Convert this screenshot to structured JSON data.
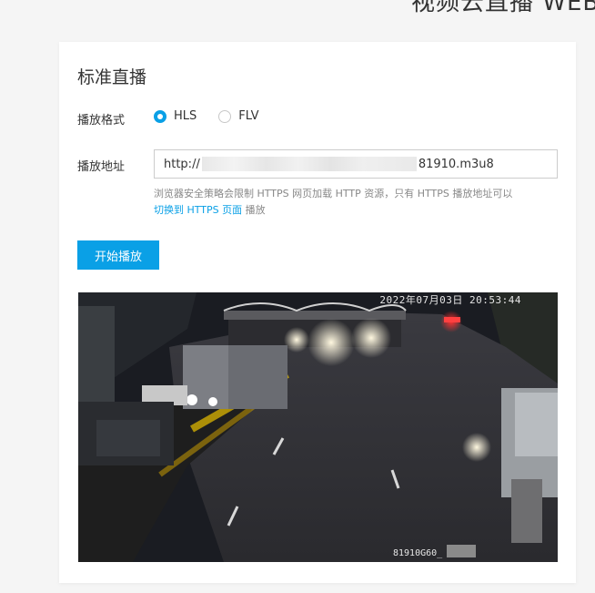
{
  "header": {
    "title": "视频云直播 WEB"
  },
  "card": {
    "title": "标准直播",
    "format": {
      "label": "播放格式",
      "options": [
        {
          "label": "HLS",
          "checked": true
        },
        {
          "label": "FLV",
          "checked": false
        }
      ]
    },
    "address": {
      "label": "播放地址",
      "url_prefix": "http://",
      "url_suffix": "81910.m3u8"
    },
    "hint": {
      "text_before": "浏览器安全策略会限制 HTTPS 网页加载 HTTP 资源，只有 HTTPS 播放地址可以",
      "link": "切换到 HTTPS 页面",
      "text_after": " 播放"
    },
    "start_button": "开始播放"
  },
  "video": {
    "timestamp": "2022年07月03日 20:53:44",
    "camera_id": "81910G60_"
  },
  "colors": {
    "accent": "#0aa0e6"
  }
}
